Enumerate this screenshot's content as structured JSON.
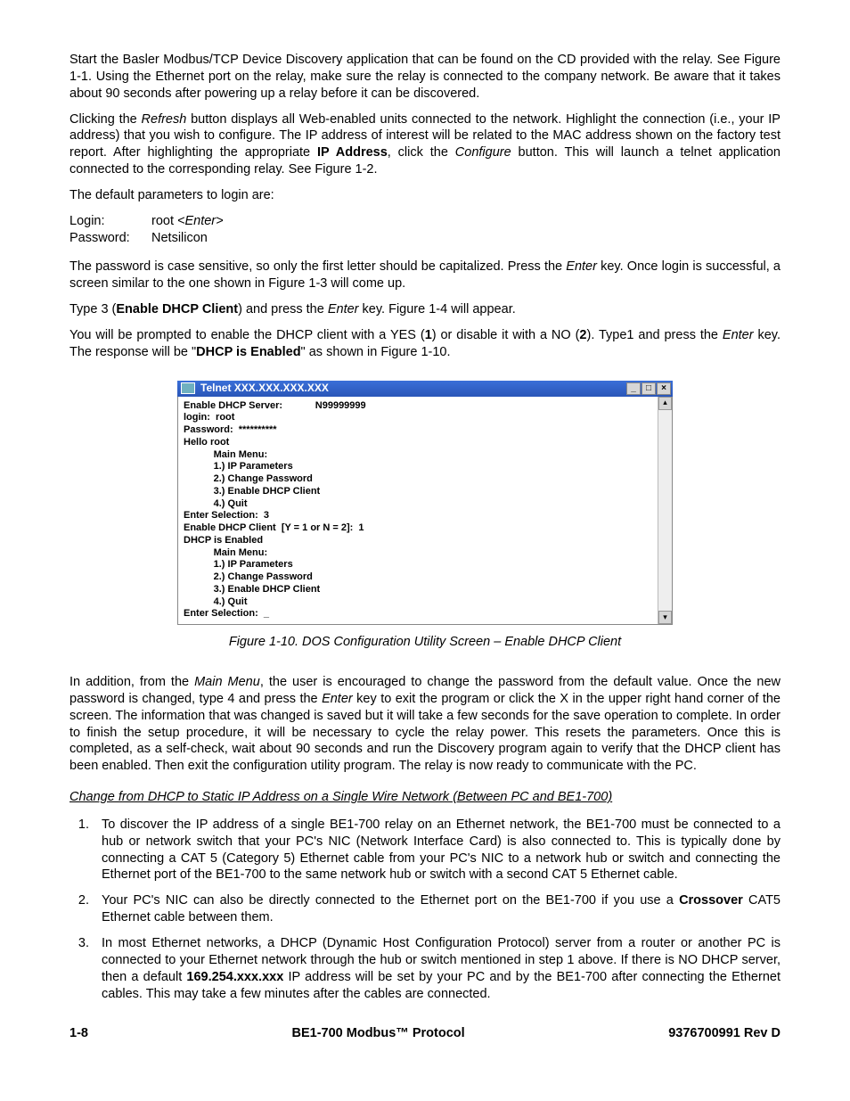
{
  "para1": "Start the Basler Modbus/TCP Device Discovery application that can be found on the CD provided with the relay. See Figure 1-1. Using the Ethernet port on the relay, make sure the relay is connected to the company network. Be aware that it takes about 90 seconds after powering up a relay before it can be discovered.",
  "para2_a": "Clicking the ",
  "para2_refresh": "Refresh",
  "para2_b": " button displays all Web-enabled units connected to the network. Highlight the connection (i.e., your IP address) that you wish to configure. The IP address of interest will be related to the MAC address shown on the factory test report. After highlighting the appropriate ",
  "para2_ip": "IP Address",
  "para2_c": ", click the ",
  "para2_configure": "Configure",
  "para2_d": " button. This will launch a telnet application connected to the corresponding relay. See Figure 1-2.",
  "default_params_line": "The default parameters to login are:",
  "login_label": "Login:",
  "login_value_a": "root  ",
  "login_value_b": "<Enter>",
  "password_label": "Password:",
  "password_value": "Netsilicon",
  "para3_a": "The password is case sensitive, so only the first letter should be capitalized. Press the ",
  "para3_enter": "Enter",
  "para3_b": " key. Once login is successful, a screen similar to the one shown in Figure 1-3 will come up.",
  "para4_a": "Type 3 (",
  "para4_bold": "Enable DHCP Client",
  "para4_b": ") and press the ",
  "para4_enter": "Enter",
  "para4_c": " key. Figure 1-4 will appear.",
  "para5_a": "You will be prompted to enable the DHCP client with a YES (",
  "para5_one": "1",
  "para5_b": ") or disable it with a NO (",
  "para5_two": "2",
  "para5_c": "). Type1 and press the ",
  "para5_enter": "Enter",
  "para5_d": " key. The response will be \"",
  "para5_bold2": "DHCP is Enabled",
  "para5_e": "\" as shown in Figure 1-10.",
  "telnet": {
    "title": "Telnet XXX.XXX.XXX.XXX",
    "line1a": "Enable DHCP Server:",
    "line1b": "N99999999",
    "line2": "login:  root",
    "line3": "Password:  **********",
    "line4": "Hello root",
    "mm": "Main Menu:",
    "m1": "1.) IP Parameters",
    "m2": "2.) Change Password",
    "m3": "3.) Enable DHCP Client",
    "m4": "4.) Quit",
    "es3": "Enter Selection:  3",
    "edc": "Enable DHCP Client  [Y = 1 or N = 2]:  1",
    "die": "DHCP is Enabled",
    "es": "Enter Selection:  _"
  },
  "fig_caption": "Figure 1-10. DOS Configuration Utility Screen – Enable DHCP Client",
  "para6_a": "In addition, from the ",
  "para6_mm": "Main Menu",
  "para6_b": ", the user is encouraged to change the password from the default value. Once the new password is changed, type 4 and press the ",
  "para6_enter": "Enter",
  "para6_c": " key to exit the program or click the X in the upper right hand corner of the screen. The information that was changed is saved but it will take a few seconds for the save operation to complete. In order to finish the setup procedure, it will be necessary to cycle the relay power. This resets the parameters. Once this is completed, as a self-check, wait about 90 seconds and run the Discovery program again to verify that the DHCP client has been enabled. Then exit the configuration utility program. The relay is now ready to communicate with the PC.",
  "subheading": "Change from DHCP to Static IP Address on a Single Wire Network (Between PC and BE1-700)",
  "step1": "To discover the IP address of a single BE1-700 relay on an Ethernet network, the BE1-700 must be connected to a hub or network switch that your PC's NIC (Network Interface Card) is also connected to. This is typically done by connecting a CAT 5 (Category 5) Ethernet cable from your PC's NIC to a network hub or switch and connecting the Ethernet port of the BE1-700 to the same network hub or switch with a second CAT 5 Ethernet cable.",
  "step2_a": "Your PC's NIC can also be directly connected to the Ethernet port on the BE1-700 if you use a ",
  "step2_bold": "Crossover",
  "step2_b": " CAT5 Ethernet cable between them.",
  "step3_a": "In most Ethernet networks, a DHCP (Dynamic Host Configuration Protocol) server from a router or another PC is connected to your Ethernet network through the hub or switch mentioned in step 1 above. If there is NO DHCP server, then a default ",
  "step3_bold": "169.254.xxx.xxx",
  "step3_b": " IP address will be set by your PC and by the BE1-700 after connecting the Ethernet cables. This may take a few minutes after the cables are connected.",
  "footer": {
    "left": "1-8",
    "center": "BE1-700 Modbus™ Protocol",
    "right": "9376700991 Rev D"
  }
}
